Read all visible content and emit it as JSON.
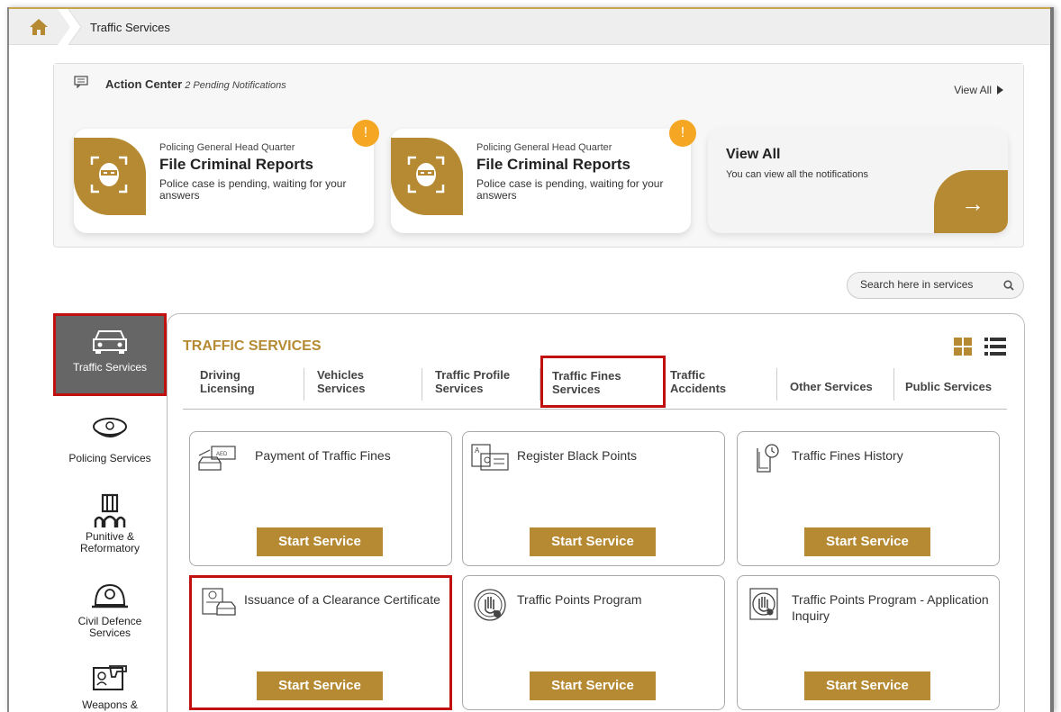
{
  "breadcrumb": {
    "current": "Traffic Services"
  },
  "action_center": {
    "title": "Action Center",
    "pending": "2 Pending Notifications",
    "view_all": "View All",
    "notifications": [
      {
        "org": "Policing General Head Quarter",
        "title": "File Criminal Reports",
        "desc": "Police case is pending, waiting for your answers",
        "alert": "!"
      },
      {
        "org": "Policing General Head Quarter",
        "title": "File Criminal Reports",
        "desc": "Police case is pending, waiting for your answers",
        "alert": "!"
      }
    ],
    "view_all_card": {
      "title": "View All",
      "sub": "You can view all the notifications",
      "arrow": "→"
    }
  },
  "search": {
    "placeholder": "Search here in services"
  },
  "sidebar": {
    "items": [
      {
        "label": "Traffic Services",
        "icon": "car-icon"
      },
      {
        "label": "Policing Services",
        "icon": "police-cap-icon"
      },
      {
        "label": "Punitive & Reformatory",
        "icon": "prison-icon"
      },
      {
        "label": "Civil Defence Services",
        "icon": "firefighter-helmet-icon"
      },
      {
        "label": "Weapons &",
        "icon": "weapon-license-icon"
      }
    ]
  },
  "panel": {
    "title": "TRAFFIC SERVICES",
    "tabs": [
      {
        "line1": "Driving",
        "line2": "Licensing"
      },
      {
        "line1": "Vehicles",
        "line2": "Services"
      },
      {
        "line1": "Traffic Profile",
        "line2": "Services"
      },
      {
        "line1": "Traffic Fines",
        "line2": "Services"
      },
      {
        "line1": "Traffic",
        "line2": "Accidents"
      },
      {
        "line1": "Other Services",
        "line2": ""
      },
      {
        "line1": "Public Services",
        "line2": ""
      }
    ],
    "services": [
      {
        "label": "Payment of Traffic Fines",
        "icon": "fine-payment-icon",
        "button": "Start Service"
      },
      {
        "label": "Register Black Points",
        "icon": "id-card-icon",
        "button": "Start Service"
      },
      {
        "label": "Traffic Fines History",
        "icon": "history-document-icon",
        "button": "Start Service"
      },
      {
        "label": "Issuance of a Clearance Certificate",
        "icon": "certificate-icon",
        "button": "Start Service"
      },
      {
        "label": "Traffic Points Program",
        "icon": "hand-stop-icon",
        "button": "Start Service"
      },
      {
        "label": "Traffic Points Program - Application Inquiry",
        "icon": "hand-stop-inquiry-icon",
        "button": "Start Service"
      }
    ]
  },
  "colors": {
    "gold": "#b58a32",
    "highlight": "#c01010",
    "alert": "#f5a623",
    "active_tab_bg": "#666666"
  }
}
